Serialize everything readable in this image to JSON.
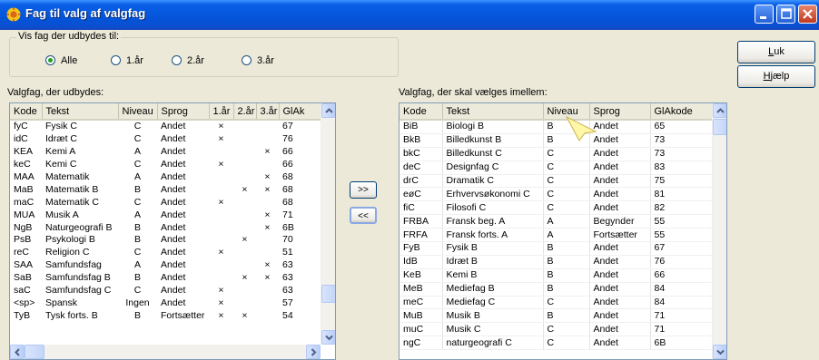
{
  "window": {
    "title": "Fag til valg af valgfag"
  },
  "filter": {
    "group_title": "Vis fag der udbydes til:",
    "options": [
      "Alle",
      "1.år",
      "2.år",
      "3.år"
    ],
    "selected": "Alle"
  },
  "buttons": {
    "close": "Luk",
    "help": "Hjælp",
    "add": ">>",
    "remove": "<<"
  },
  "left": {
    "label": "Valgfag, der udbydes:",
    "columns": [
      "Kode",
      "Tekst",
      "Niveau",
      "Sprog",
      "1.år",
      "2.år",
      "3.år",
      "GlAk"
    ],
    "rows": [
      [
        "fyC",
        "Fysik C",
        "C",
        "Andet",
        "×",
        "",
        "",
        "67"
      ],
      [
        "idC",
        "Idræt C",
        "C",
        "Andet",
        "×",
        "",
        "",
        "76"
      ],
      [
        "KEA",
        "Kemi A",
        "A",
        "Andet",
        "",
        "",
        "×",
        "66"
      ],
      [
        "keC",
        "Kemi C",
        "C",
        "Andet",
        "×",
        "",
        "",
        "66"
      ],
      [
        "MAA",
        "Matematik",
        "A",
        "Andet",
        "",
        "",
        "×",
        "68"
      ],
      [
        "MaB",
        "Matematik B",
        "B",
        "Andet",
        "",
        "×",
        "×",
        "68"
      ],
      [
        "maC",
        "Matematik C",
        "C",
        "Andet",
        "×",
        "",
        "",
        "68"
      ],
      [
        "MUA",
        "Musik A",
        "A",
        "Andet",
        "",
        "",
        "×",
        "71"
      ],
      [
        "NgB",
        "Naturgeografi B",
        "B",
        "Andet",
        "",
        "",
        "×",
        "6B"
      ],
      [
        "PsB",
        "Psykologi B",
        "B",
        "Andet",
        "",
        "×",
        "",
        "70"
      ],
      [
        "reC",
        "Religion C",
        "C",
        "Andet",
        "×",
        "",
        "",
        "51"
      ],
      [
        "SAA",
        "Samfundsfag",
        "A",
        "Andet",
        "",
        "",
        "×",
        "63"
      ],
      [
        "SaB",
        "Samfundsfag B",
        "B",
        "Andet",
        "",
        "×",
        "×",
        "63"
      ],
      [
        "saC",
        "Samfundsfag C",
        "C",
        "Andet",
        "×",
        "",
        "",
        "63"
      ],
      [
        "<sp>",
        "Spansk",
        "Ingen",
        "Andet",
        "×",
        "",
        "",
        "57"
      ],
      [
        "TyB",
        "Tysk forts. B",
        "B",
        "Fortsætter",
        "×",
        "×",
        "",
        "54"
      ]
    ]
  },
  "right": {
    "label": "Valgfag, der skal vælges imellem:",
    "columns": [
      "Kode",
      "Tekst",
      "Niveau",
      "Sprog",
      "GlAkode"
    ],
    "rows": [
      [
        "BiB",
        "Biologi B",
        "B",
        "Andet",
        "65"
      ],
      [
        "BkB",
        "Billedkunst B",
        "B",
        "Andet",
        "73"
      ],
      [
        "bkC",
        "Billedkunst C",
        "C",
        "Andet",
        "73"
      ],
      [
        "deC",
        "Designfag C",
        "C",
        "Andet",
        "83"
      ],
      [
        "drC",
        "Dramatik C",
        "C",
        "Andet",
        "75"
      ],
      [
        "eøC",
        "Erhvervsøkonomi C",
        "C",
        "Andet",
        "81"
      ],
      [
        "fiC",
        "Filosofi C",
        "C",
        "Andet",
        "82"
      ],
      [
        "FRBA",
        "Fransk beg. A",
        "A",
        "Begynder",
        "55"
      ],
      [
        "FRFA",
        "Fransk forts. A",
        "A",
        "Fortsætter",
        "55"
      ],
      [
        "FyB",
        "Fysik B",
        "B",
        "Andet",
        "67"
      ],
      [
        "IdB",
        "Idræt B",
        "B",
        "Andet",
        "76"
      ],
      [
        "KeB",
        "Kemi B",
        "B",
        "Andet",
        "66"
      ],
      [
        "MeB",
        "Mediefag B",
        "B",
        "Andet",
        "84"
      ],
      [
        "meC",
        "Mediefag C",
        "C",
        "Andet",
        "84"
      ],
      [
        "MuB",
        "Musik B",
        "B",
        "Andet",
        "71"
      ],
      [
        "muC",
        "Musik C",
        "C",
        "Andet",
        "71"
      ],
      [
        "ngC",
        "naturgeografi C",
        "C",
        "Andet",
        "6B"
      ]
    ]
  },
  "colors": {
    "title_bar": "#0454D9",
    "dialog_bg": "#ECE9D8",
    "list_border": "#7F9DB9"
  }
}
